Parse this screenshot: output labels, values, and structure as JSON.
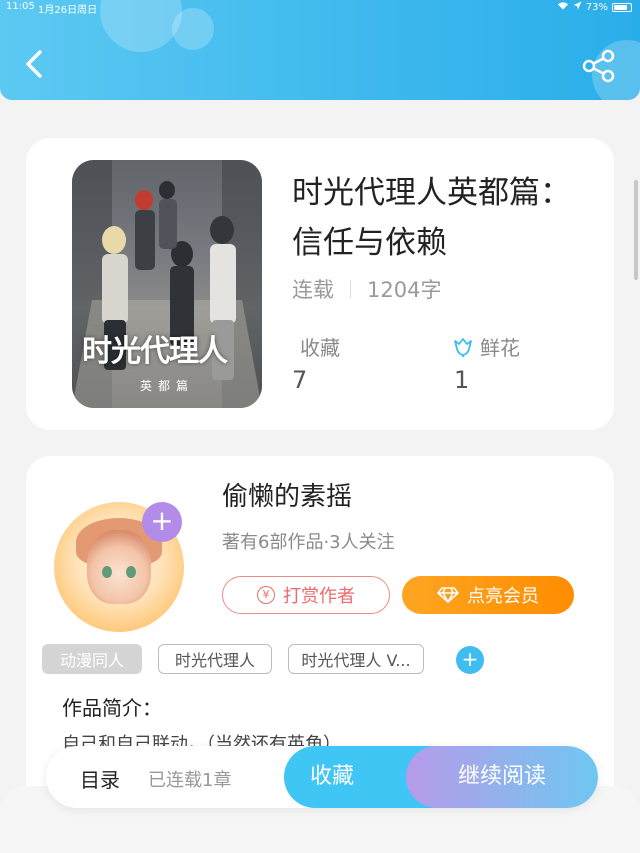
{
  "status_bar": {
    "time": "11:05",
    "date": "1月26日周日",
    "battery": "73%"
  },
  "book": {
    "cover_title": "时光代理人",
    "cover_subtitle": "英都篇",
    "title": "时光代理人英都篇：信任与依赖",
    "status": "连载",
    "word_count": "1204字",
    "favorites_label": "收藏",
    "favorites_value": "7",
    "flowers_label": "鲜花",
    "flowers_value": "1"
  },
  "author": {
    "name": "偷懒的素摇",
    "stats": "著有6部作品·3人关注",
    "tip_button": "打赏作者",
    "vip_button": "点亮会员"
  },
  "tags": [
    "动漫同人",
    "时光代理人",
    "时光代理人 V..."
  ],
  "intro": {
    "label": "作品简介：",
    "text": "自己和自己联动。（当然还有英角）"
  },
  "bottom_bar": {
    "toc_label": "目录",
    "toc_sub": "已连载1章",
    "collect_button": "收藏",
    "read_button": "继续阅读"
  },
  "colors": {
    "header": "#3fb9ee",
    "vip": "#ff9a10",
    "tip": "#ee6b6b",
    "collect": "#3fc6f4"
  }
}
